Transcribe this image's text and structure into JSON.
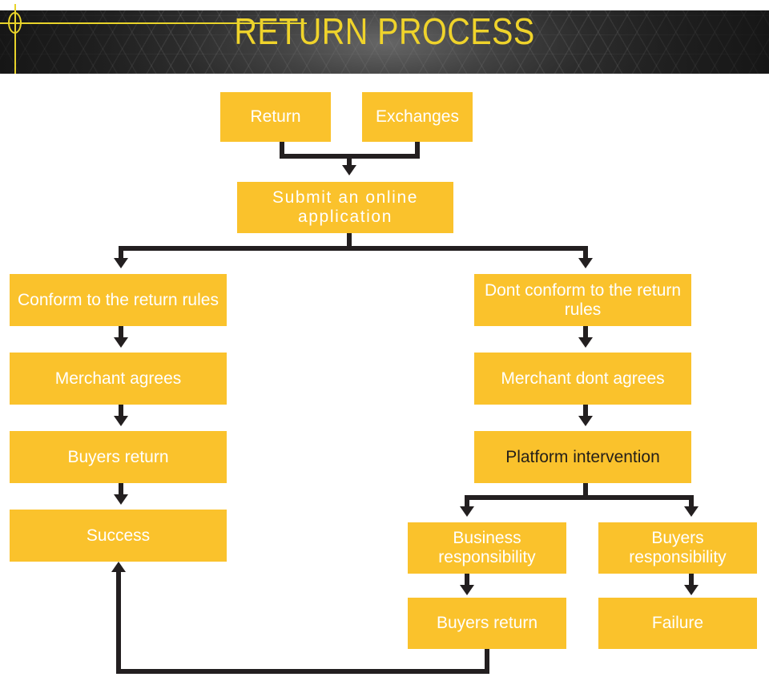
{
  "header": {
    "title": "RETURN PROCESS",
    "title_color": "#efd32b",
    "band_color": "#2b2b2b",
    "accent_color": "#e8d32a",
    "decorations": [
      "crosshair-circle",
      "horizontal-rule",
      "vertical-rule"
    ]
  },
  "theme": {
    "node_fill": "#fac22c",
    "node_text": "#ffffff",
    "node_text_alt": "#241f19",
    "connector_color": "#231f20",
    "page_background": "#ffffff"
  },
  "flowchart": {
    "type": "process-flow-diagram",
    "nodes": [
      {
        "id": "return",
        "label": "Return"
      },
      {
        "id": "exchanges",
        "label": "Exchanges"
      },
      {
        "id": "submit",
        "label": "Submit an online application"
      },
      {
        "id": "conform",
        "label": "Conform to the return rules"
      },
      {
        "id": "merchant-agrees",
        "label": "Merchant agrees"
      },
      {
        "id": "buyers-return-left",
        "label": "Buyers return"
      },
      {
        "id": "success",
        "label": "Success"
      },
      {
        "id": "dont-conform",
        "label": "Dont conform to the return rules"
      },
      {
        "id": "merchant-dont",
        "label": "Merchant dont agrees"
      },
      {
        "id": "platform",
        "label": "Platform intervention"
      },
      {
        "id": "business-resp",
        "label": "Business responsibility"
      },
      {
        "id": "buyers-resp",
        "label": "Buyers responsibility"
      },
      {
        "id": "buyers-return-right",
        "label": "Buyers return"
      },
      {
        "id": "failure",
        "label": "Failure"
      }
    ],
    "edges": [
      {
        "from": "return",
        "to": "submit"
      },
      {
        "from": "exchanges",
        "to": "submit"
      },
      {
        "from": "submit",
        "to": "conform"
      },
      {
        "from": "submit",
        "to": "dont-conform"
      },
      {
        "from": "conform",
        "to": "merchant-agrees"
      },
      {
        "from": "merchant-agrees",
        "to": "buyers-return-left"
      },
      {
        "from": "buyers-return-left",
        "to": "success"
      },
      {
        "from": "dont-conform",
        "to": "merchant-dont"
      },
      {
        "from": "merchant-dont",
        "to": "platform"
      },
      {
        "from": "platform",
        "to": "business-resp"
      },
      {
        "from": "platform",
        "to": "buyers-resp"
      },
      {
        "from": "business-resp",
        "to": "buyers-return-right"
      },
      {
        "from": "buyers-resp",
        "to": "failure"
      },
      {
        "from": "buyers-return-right",
        "to": "success"
      }
    ]
  }
}
